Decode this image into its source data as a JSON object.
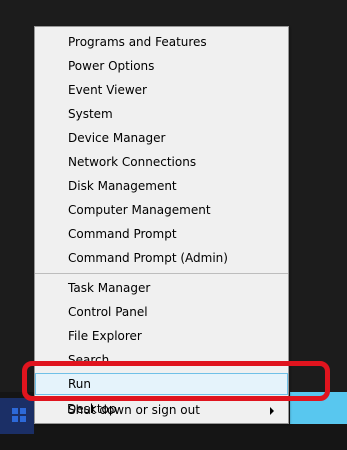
{
  "context_menu": {
    "items": [
      {
        "label": "Programs and Features"
      },
      {
        "label": "Power Options"
      },
      {
        "label": "Event Viewer"
      },
      {
        "label": "System"
      },
      {
        "label": "Device Manager"
      },
      {
        "label": "Network Connections"
      },
      {
        "label": "Disk Management"
      },
      {
        "label": "Computer Management"
      },
      {
        "label": "Command Prompt"
      },
      {
        "label": "Command Prompt (Admin)"
      },
      {
        "label": "Task Manager"
      },
      {
        "label": "Control Panel"
      },
      {
        "label": "File Explorer"
      },
      {
        "label": "Search"
      },
      {
        "label": "Run",
        "selected": true
      },
      {
        "label": "Shut down or sign out",
        "submenu": true
      },
      {
        "label": "Desktop"
      }
    ]
  },
  "colors": {
    "menu_background": "#f0f0f0",
    "selection_fill": "#e5f3fb",
    "selection_border": "#70c0e7",
    "annotation_red": "#e0141e",
    "tile_blue": "#58c7ef"
  },
  "icons": {
    "start_button": "windows-logo-icon",
    "submenu_indicator": "chevron-right-icon"
  }
}
